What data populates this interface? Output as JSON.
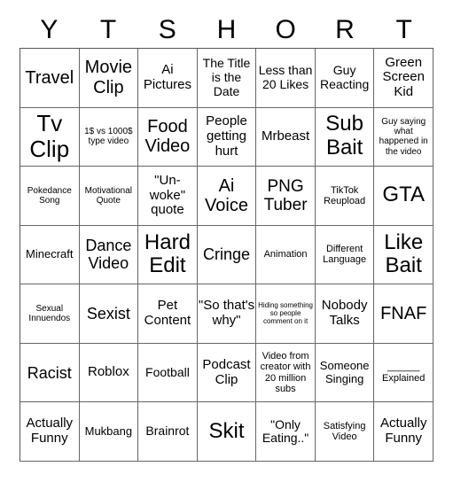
{
  "title_letters": [
    "Y",
    "T",
    "S",
    "H",
    "O",
    "R",
    "T"
  ],
  "rows": [
    [
      "Travel",
      "Movie Clip",
      "Ai Pictures",
      "The Title is the Date",
      "Less than 20 Likes",
      "Guy Reacting",
      "Green Screen Kid"
    ],
    [
      "Tv Clip",
      "1$ vs 1000$ type video",
      "Food Video",
      "People getting hurt",
      "Mrbeast",
      "Sub Bait",
      "Guy saying what happened in the video"
    ],
    [
      "Pokedance Song",
      "Motivational Quote",
      "\"Un-woke\" quote",
      "Ai Voice",
      "PNG Tuber",
      "TikTok Reupload",
      "GTA"
    ],
    [
      "Minecraft",
      "Dance Video",
      "Hard Edit",
      "Cringe",
      "Animation",
      "Different Language",
      "Like Bait"
    ],
    [
      "Sexual Innuendos",
      "Sexist",
      "Pet Content",
      "\"So that's why\"",
      "Hiding something so people comment on it",
      "Nobody Talks",
      "FNAF"
    ],
    [
      "Racist",
      "Roblox",
      "Football",
      "Podcast Clip",
      "Video from creator with 20 million subs",
      "Someone Singing",
      "______ Explained"
    ],
    [
      "Actually Funny",
      "Mukbang",
      "Brainrot",
      "Skit",
      "\"Only Eating..\"",
      "Satisfying Video",
      "Actually Funny"
    ]
  ]
}
